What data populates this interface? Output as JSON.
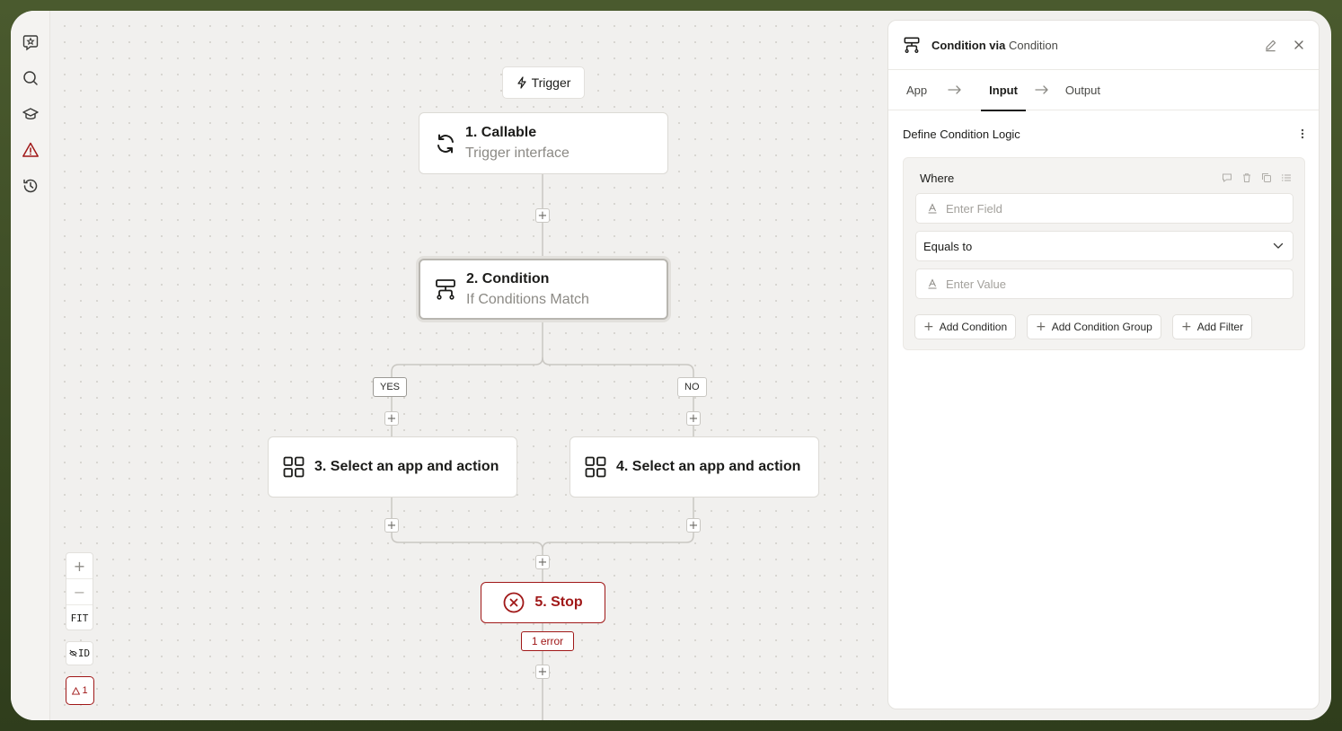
{
  "sidebar": {
    "icons": [
      "star-chat-icon",
      "search-icon",
      "graduation-cap-icon",
      "warning-icon",
      "history-icon"
    ]
  },
  "canvas": {
    "trigger_label": "Trigger",
    "nodes": [
      {
        "title": "1. Callable",
        "subtitle": "Trigger interface"
      },
      {
        "title": "2. Condition",
        "subtitle": "If Conditions Match"
      },
      {
        "title": "3. Select an app and action"
      },
      {
        "title": "4. Select an app and action"
      },
      {
        "title": "5. Stop"
      }
    ],
    "branch_yes": "YES",
    "branch_no": "NO",
    "error_badge": "1 error",
    "zoom": {
      "in": "+",
      "out": "−",
      "fit": "FIT",
      "id": "ID",
      "warning_count": "1"
    }
  },
  "panel": {
    "title_prefix": "Condition via",
    "title_app": "Condition",
    "tabs": [
      "App",
      "Input",
      "Output"
    ],
    "active_tab": "Input",
    "section_title": "Define Condition Logic",
    "group_label": "Where",
    "field_placeholder": "Enter Field",
    "operator": "Equals to",
    "value_placeholder": "Enter Value",
    "buttons": [
      "Add Condition",
      "Add Condition Group",
      "Add Filter"
    ]
  },
  "colors": {
    "error": "#a01818",
    "accent": "#1c1c1a"
  }
}
